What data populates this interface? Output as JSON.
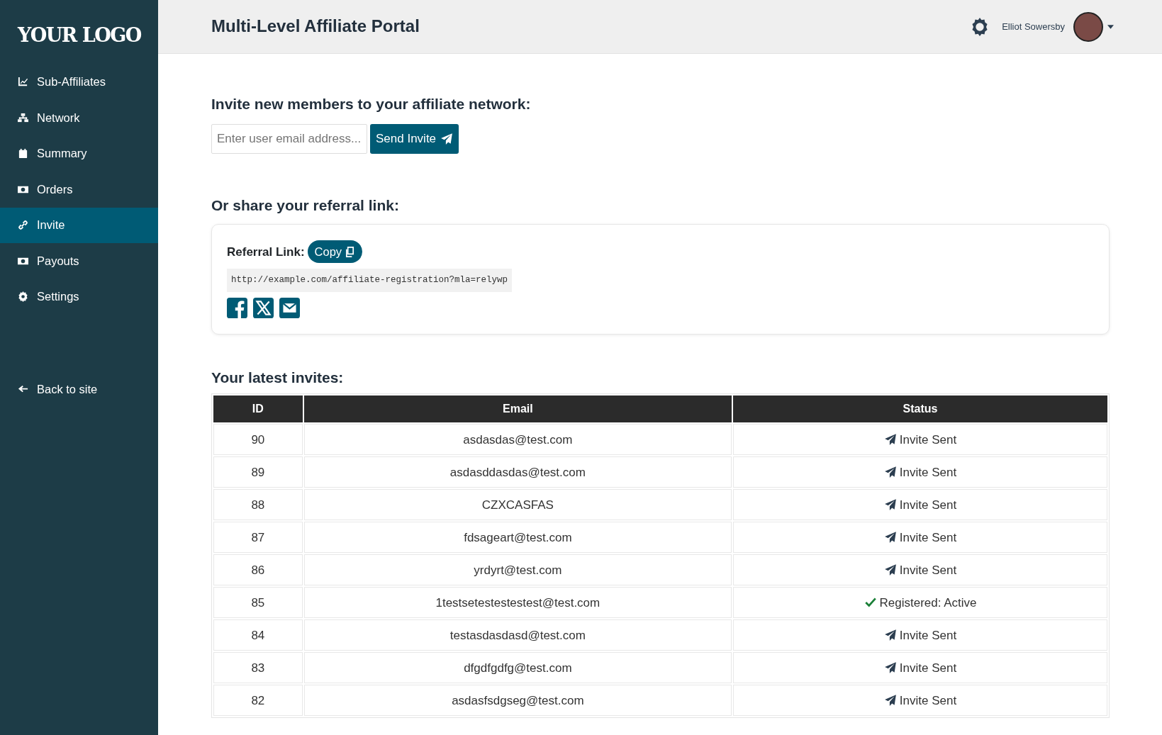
{
  "sidebar": {
    "logo": "YOUR LOGO",
    "items": [
      {
        "label": "Sub-Affiliates",
        "kind": "chart",
        "selected": false
      },
      {
        "label": "Network",
        "kind": "network",
        "selected": false
      },
      {
        "label": "Summary",
        "kind": "calendar",
        "selected": false
      },
      {
        "label": "Orders",
        "kind": "money",
        "selected": false
      },
      {
        "label": "Invite",
        "kind": "link",
        "selected": true
      },
      {
        "label": "Payouts",
        "kind": "money",
        "selected": false
      },
      {
        "label": "Settings",
        "kind": "gear",
        "selected": false
      }
    ],
    "back_link": "Back to site"
  },
  "header": {
    "title": "Multi-Level Affiliate Portal",
    "user_name": "Elliot Sowersby"
  },
  "invite": {
    "heading": "Invite new members to your affiliate network:",
    "email_field": {
      "placeholder": "Enter user email address..."
    },
    "button": "Send Invite"
  },
  "referral": {
    "heading": "Or share your referral link:",
    "label": "Referral Link:",
    "copy_button": "Copy",
    "url": "http://example.com/affiliate-registration?mla=relywp"
  },
  "invites_table": {
    "heading": "Your latest invites:",
    "columns": [
      "ID",
      "Email",
      "Status"
    ],
    "rows": [
      {
        "id": "90",
        "email": "asdasdas@test.com",
        "status": "Invite Sent",
        "kind": "sent"
      },
      {
        "id": "89",
        "email": "asdasddasdas@test.com",
        "status": "Invite Sent",
        "kind": "sent"
      },
      {
        "id": "88",
        "email": "CZXCASFAS",
        "status": "Invite Sent",
        "kind": "sent"
      },
      {
        "id": "87",
        "email": "fdsageart@test.com",
        "status": "Invite Sent",
        "kind": "sent"
      },
      {
        "id": "86",
        "email": "yrdyrt@test.com",
        "status": "Invite Sent",
        "kind": "sent"
      },
      {
        "id": "85",
        "email": "1testsetestestestest@test.com",
        "status": "Registered: Active",
        "kind": "registered"
      },
      {
        "id": "84",
        "email": "testasdasdasd@test.com",
        "status": "Invite Sent",
        "kind": "sent"
      },
      {
        "id": "83",
        "email": "dfgdfgdfg@test.com",
        "status": "Invite Sent",
        "kind": "sent"
      },
      {
        "id": "82",
        "email": "asdasfsdgseg@test.com",
        "status": "Invite Sent",
        "kind": "sent"
      }
    ]
  }
}
